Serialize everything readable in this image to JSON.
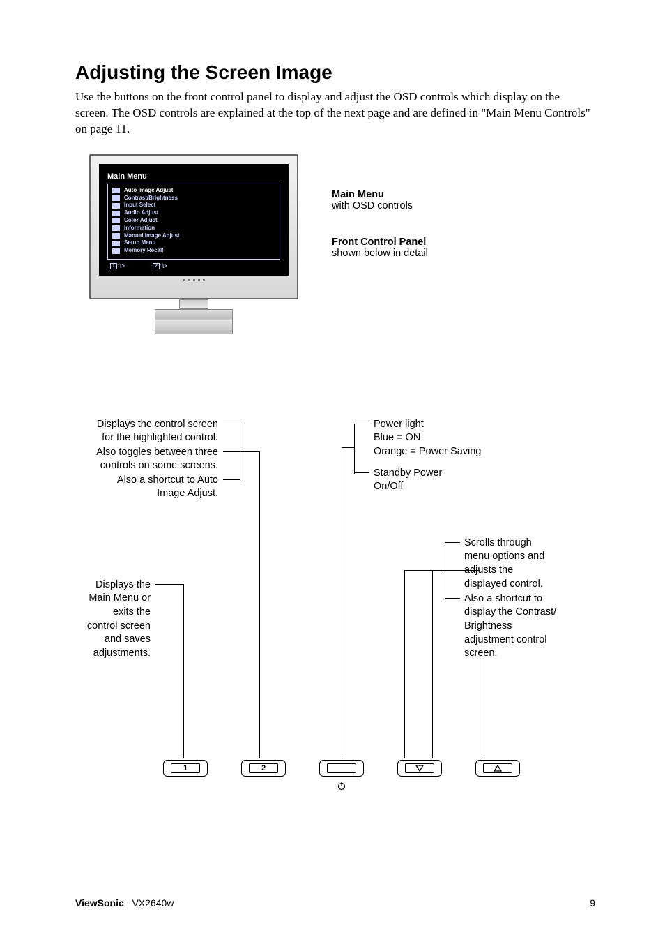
{
  "heading": "Adjusting the Screen Image",
  "intro": "Use the buttons on the front control panel to display and adjust the OSD controls which display on the screen. The OSD controls are explained at the top of the next page and are defined in \"Main Menu Controls\" on page 11.",
  "osd": {
    "title": "Main Menu",
    "items": [
      "Auto Image Adjust",
      "Contrast/Brightness",
      "Input Select",
      "Audio Adjust",
      "Color Adjust",
      "Information",
      "Manual Image Adjust",
      "Setup Menu",
      "Memory Recall"
    ],
    "footer1_box": "1",
    "footer1_rest": ":",
    "footer2_box": "2",
    "footer2_rest": ":"
  },
  "upper_labels": {
    "main_menu_title": "Main Menu",
    "main_menu_sub": "with OSD controls",
    "fcp_title": "Front Control Panel",
    "fcp_sub": "shown below in detail"
  },
  "lower_labels": {
    "left1a": "Displays the control screen",
    "left1b": "for the highlighted control.",
    "left2a": "Also toggles between three",
    "left2b": "controls on some screens.",
    "left3a": "Also a shortcut to Auto",
    "left3b": "Image Adjust.",
    "left4a": "Displays the",
    "left4b": "Main Menu or",
    "left4c": "exits the",
    "left4d": "control screen",
    "left4e": "and saves",
    "left4f": "adjustments.",
    "right1": "Power light",
    "right2": "Blue = ON",
    "right3": "Orange = Power Saving",
    "right4a": "Standby Power",
    "right4b": "On/Off",
    "right5a": "Scrolls through",
    "right5b": "menu options and",
    "right5c": "adjusts the",
    "right5d": "displayed control.",
    "right6a": "Also a shortcut to",
    "right6b": "display the Contrast/",
    "right6c": "Brightness",
    "right6d": "adjustment control",
    "right6e": "screen."
  },
  "buttons": {
    "b1": "1",
    "b2": "2"
  },
  "footer": {
    "brand": "ViewSonic",
    "model": "VX2640w",
    "page": "9"
  }
}
